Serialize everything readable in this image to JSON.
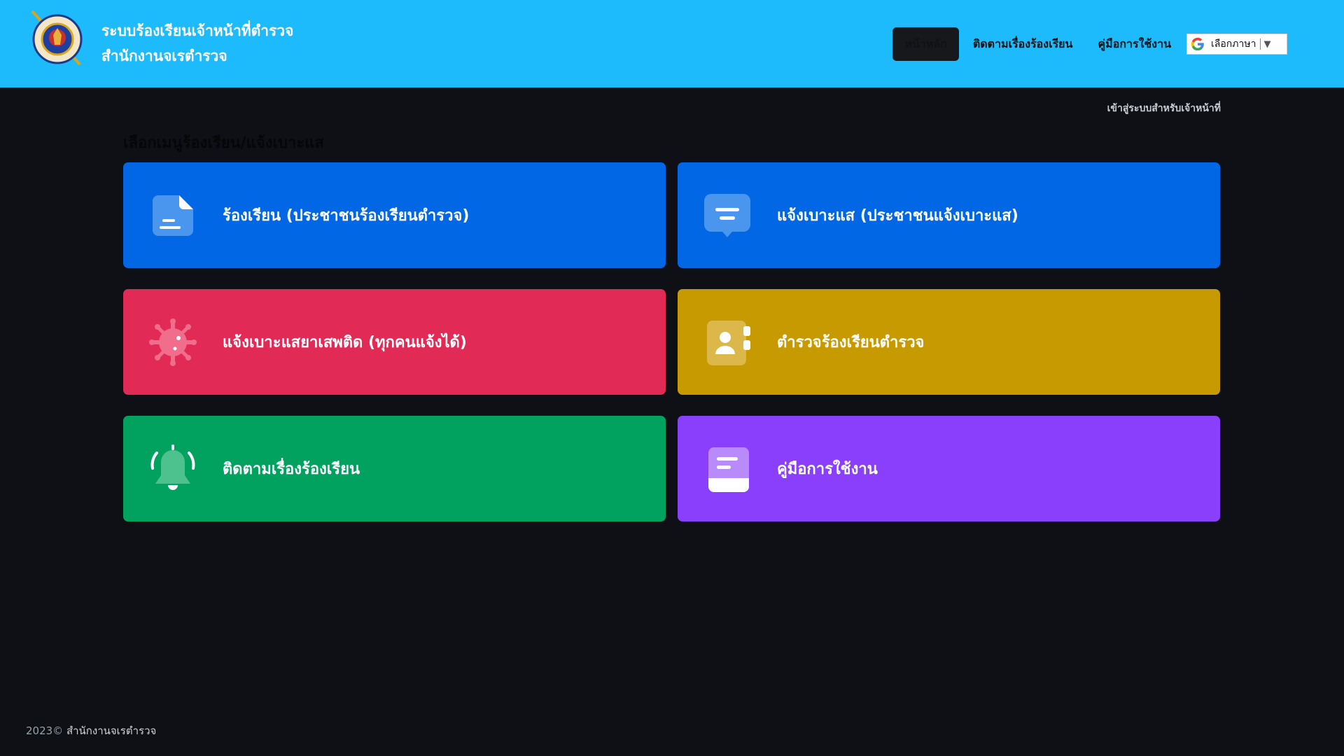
{
  "header": {
    "title_line1": "ระบบร้องเรียนเจ้าหน้าที่ตำรวจ",
    "title_line2": "สำนักงานจเรตำรวจ",
    "nav": [
      {
        "label": "หน้าหลัก",
        "active": true
      },
      {
        "label": "ติดตามเรื่องร้องเรียน",
        "active": false
      },
      {
        "label": "คู่มือการใช้งาน",
        "active": false
      }
    ],
    "language_label": "เลือกภาษา",
    "language_arrow": "▼"
  },
  "staff_login_label": "เข้าสู่ระบบสำหรับเจ้าหน้าที่",
  "section_title": "เลือกเมนูร้องเรียน/แจ้งเบาะแส",
  "cards": [
    {
      "label": "ร้องเรียน (ประชาชนร้องเรียนตำรวจ)",
      "icon": "document-icon",
      "color": "#0167e4"
    },
    {
      "label": "แจ้งเบาะแส (ประชาชนแจ้งเบาะแส)",
      "icon": "chat-icon",
      "color": "#0167e4"
    },
    {
      "label": "แจ้งเบาะแสยาเสพติด (ทุกคนแจ้งได้)",
      "icon": "virus-icon",
      "color": "#e22a57"
    },
    {
      "label": "ตำรวจร้องเรียนตำรวจ",
      "icon": "contact-book-icon",
      "color": "#c89a01"
    },
    {
      "label": "ติดตามเรื่องร้องเรียน",
      "icon": "bell-icon",
      "color": "#01a25f"
    },
    {
      "label": "คู่มือการใช้งาน",
      "icon": "book-icon",
      "color": "#8a3ffc"
    }
  ],
  "footer": {
    "year": "2023©",
    "org": "สำนักงานจเรตำรวจ"
  },
  "colors": {
    "header_bg": "#1dbbfc",
    "page_bg": "#0e1015"
  }
}
